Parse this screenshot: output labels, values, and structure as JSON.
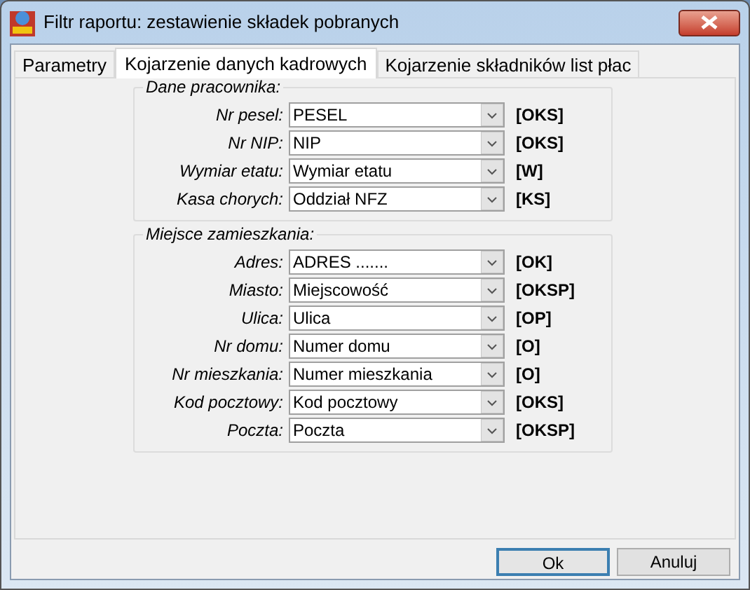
{
  "window": {
    "title": "Filtr raportu: zestawienie składek pobranych"
  },
  "tabs": [
    {
      "label": "Parametry",
      "selected": false
    },
    {
      "label": "Kojarzenie danych kadrowych",
      "selected": true
    },
    {
      "label": "Kojarzenie składników list płac",
      "selected": false
    }
  ],
  "groups": [
    {
      "title": "Dane pracownika:",
      "rows": [
        {
          "label": "Nr pesel:",
          "value": "PESEL",
          "tag": "[OKS]"
        },
        {
          "label": "Nr NIP:",
          "value": "NIP",
          "tag": "[OKS]"
        },
        {
          "label": "Wymiar etatu:",
          "value": "Wymiar etatu",
          "tag": "[W]"
        },
        {
          "label": "Kasa chorych:",
          "value": "Oddział NFZ",
          "tag": "[KS]"
        }
      ]
    },
    {
      "title": "Miejsce zamieszkania:",
      "rows": [
        {
          "label": "Adres:",
          "value": "ADRES .......",
          "tag": "[OK]"
        },
        {
          "label": "Miasto:",
          "value": "Miejscowość",
          "tag": "[OKSP]"
        },
        {
          "label": "Ulica:",
          "value": "Ulica",
          "tag": "[OP]"
        },
        {
          "label": "Nr domu:",
          "value": "Numer domu",
          "tag": "[O]"
        },
        {
          "label": "Nr mieszkania:",
          "value": "Numer mieszkania",
          "tag": "[O]"
        },
        {
          "label": "Kod pocztowy:",
          "value": "Kod pocztowy",
          "tag": "[OKS]"
        },
        {
          "label": "Poczta:",
          "value": "Poczta",
          "tag": "[OKSP]"
        }
      ]
    }
  ],
  "buttons": [
    {
      "label": "Ok",
      "default": true
    },
    {
      "label": "Anuluj",
      "default": false
    }
  ]
}
